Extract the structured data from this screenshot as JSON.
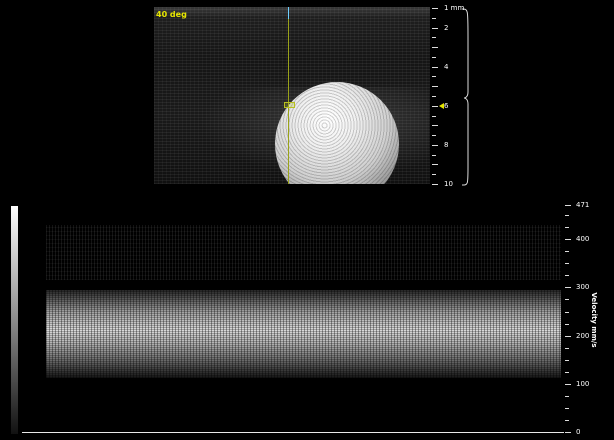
{
  "bmode": {
    "title": "40 deg",
    "depth_unit": "mm",
    "depth_max": 10,
    "marker_depth": 6,
    "depth_labels": [
      {
        "value": 1,
        "text": "1 mm"
      },
      {
        "value": 2,
        "text": "2"
      },
      {
        "value": 4,
        "text": "4"
      },
      {
        "value": 6,
        "text": "6"
      },
      {
        "value": 8,
        "text": "8"
      },
      {
        "value": 10,
        "text": "10"
      }
    ],
    "colors": {
      "title": "#e6e600",
      "cursor_line": "#9aa31a",
      "cursor_top": "#6fd0ff",
      "marker": "#e6e600"
    }
  },
  "spectrogram": {
    "axis_title": "Velocity mm/s",
    "velocity_max": 471,
    "velocity_labels": [
      {
        "value": 471,
        "text": "471"
      },
      {
        "value": 400,
        "text": "400"
      },
      {
        "value": 300,
        "text": "300"
      },
      {
        "value": 200,
        "text": "200"
      },
      {
        "value": 100,
        "text": "100"
      },
      {
        "value": 0,
        "text": "0"
      }
    ]
  }
}
